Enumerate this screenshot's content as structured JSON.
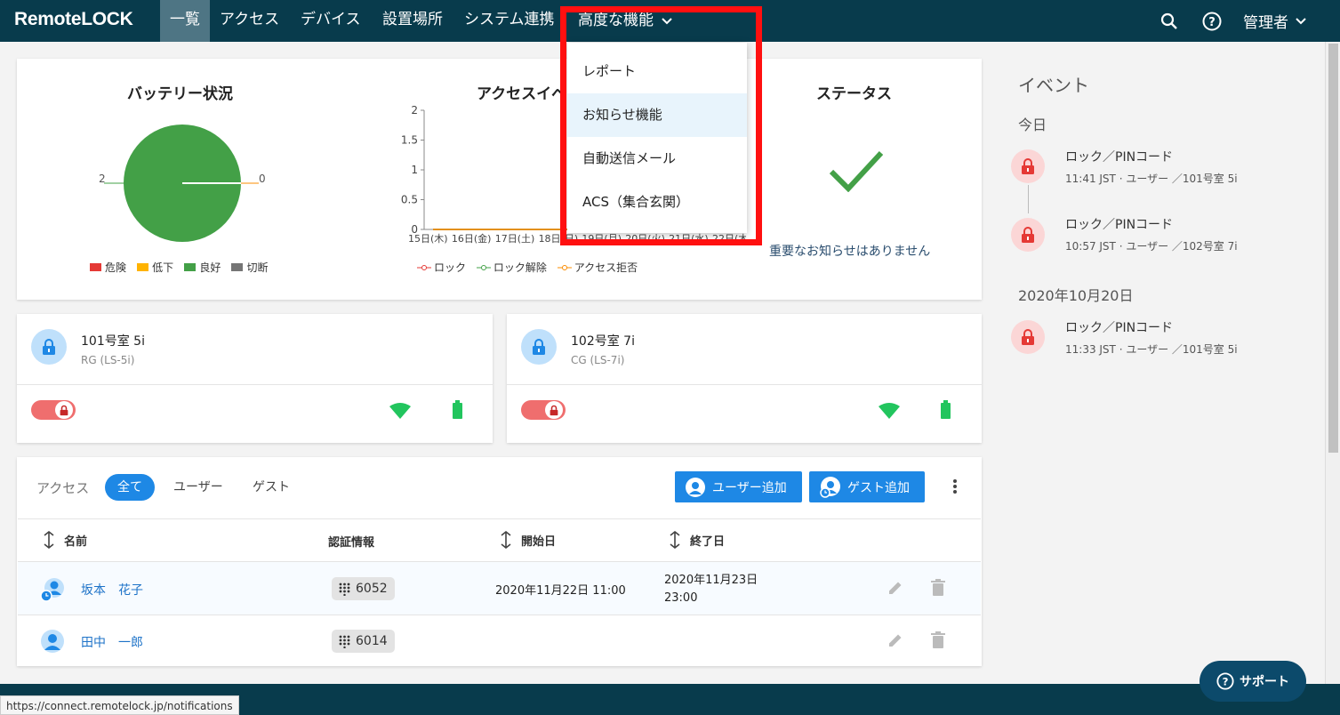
{
  "nav": {
    "logo": "RemoteLOCK",
    "items": [
      "一覧",
      "アクセス",
      "デバイス",
      "設置場所",
      "システム連携"
    ],
    "advanced": "高度な機能",
    "user": "管理者"
  },
  "dropdown": {
    "items": [
      "レポート",
      "お知らせ機能",
      "自動送信メール",
      "ACS（集合玄関）"
    ]
  },
  "battery": {
    "title": "バッテリー状況",
    "label_left": "2",
    "label_right": "0",
    "legend": [
      {
        "label": "危険",
        "color": "#e53935"
      },
      {
        "label": "低下",
        "color": "#ffb300"
      },
      {
        "label": "良好",
        "color": "#43a047"
      },
      {
        "label": "切断",
        "color": "#757575"
      }
    ]
  },
  "chart_data": {
    "type": "line",
    "title": "アクセスイベ",
    "categories": [
      "15日(木)",
      "16日(金)",
      "17日(土)",
      "18日(日)",
      "19日(月)",
      "20日(火)",
      "21日(水)",
      "22日(木"
    ],
    "ylim": [
      0,
      2
    ],
    "yticks": [
      "2",
      "1.5",
      "1",
      "0.5",
      "0"
    ],
    "series": [
      {
        "name": "ロック",
        "color": "#e53935",
        "values": [
          0,
          0,
          0,
          0,
          0,
          0,
          0,
          0
        ]
      },
      {
        "name": "ロック解除",
        "color": "#43a047",
        "values": [
          0,
          0,
          0,
          0,
          0,
          0,
          0,
          0
        ]
      },
      {
        "name": "アクセス拒否",
        "color": "#fb8c00",
        "values": [
          0,
          0,
          0,
          0,
          0,
          0,
          0,
          0
        ]
      }
    ]
  },
  "status": {
    "title": "ステータス",
    "message": "重要なお知らせはありません"
  },
  "events": {
    "title": "イベント",
    "groups": [
      {
        "date": "今日",
        "items": [
          {
            "title": "ロック／PINコード",
            "sub": "11:41 JST · ユーザー ／101号室 5i"
          },
          {
            "title": "ロック／PINコード",
            "sub": "10:57 JST · ユーザー ／102号室 7i"
          }
        ]
      },
      {
        "date": "2020年10月20日",
        "items": [
          {
            "title": "ロック／PINコード",
            "sub": "11:33 JST · ユーザー ／101号室 5i"
          }
        ]
      }
    ]
  },
  "devices": [
    {
      "name": "101号室 5i",
      "model": "RG (LS-5i)"
    },
    {
      "name": "102号室 7i",
      "model": "CG (LS-7i)"
    }
  ],
  "access": {
    "label": "アクセス",
    "tabs": [
      "全て",
      "ユーザー",
      "ゲスト"
    ],
    "add_user": "ユーザー追加",
    "add_guest": "ゲスト追加",
    "columns": [
      "名前",
      "認証情報",
      "開始日",
      "終了日"
    ],
    "rows": [
      {
        "name": "坂本　花子",
        "pin": "6052",
        "start": "2020年11月22日 11:00",
        "end_line1": "2020年11月23日",
        "end_line2": "23:00"
      },
      {
        "name": "田中　一郎",
        "pin": "6014",
        "start": "",
        "end_line1": "",
        "end_line2": ""
      }
    ]
  },
  "support": "サポート",
  "status_url": "https://connect.remotelock.jp/notifications"
}
